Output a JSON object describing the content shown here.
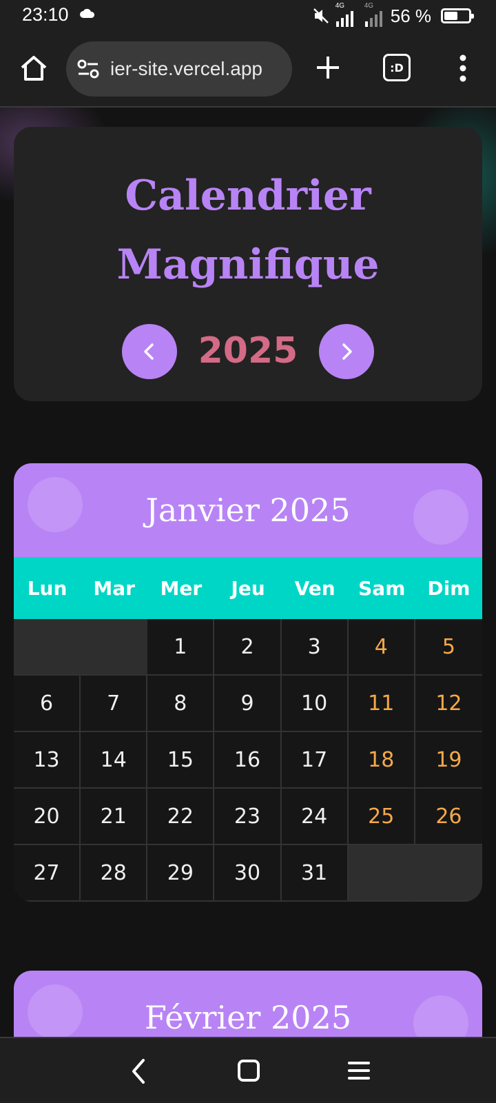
{
  "status_bar": {
    "time": "23:10",
    "battery_text": "56 %",
    "battery_level_percent": 56,
    "network_label_1": "4G",
    "network_label_2": "4G"
  },
  "browser": {
    "url_text": "ier-site.vercel.app",
    "tab_switcher_label": ":D"
  },
  "header": {
    "title_line1": "Calendrier",
    "title_line2": "Magnifique",
    "year": "2025",
    "prev_icon": "chevron-left-icon",
    "next_icon": "chevron-right-icon"
  },
  "weekdays": [
    "Lun",
    "Mar",
    "Mer",
    "Jeu",
    "Ven",
    "Sam",
    "Dim"
  ],
  "months": [
    {
      "title": "Janvier 2025",
      "leading_empty": 2,
      "days": 31
    },
    {
      "title": "Février 2025"
    }
  ],
  "colors": {
    "accent_purple": "#b884f5",
    "weekday_bar": "#00d6c6",
    "year_color": "#d46a86",
    "weekend_color": "#f5a94a",
    "background": "#131313"
  }
}
